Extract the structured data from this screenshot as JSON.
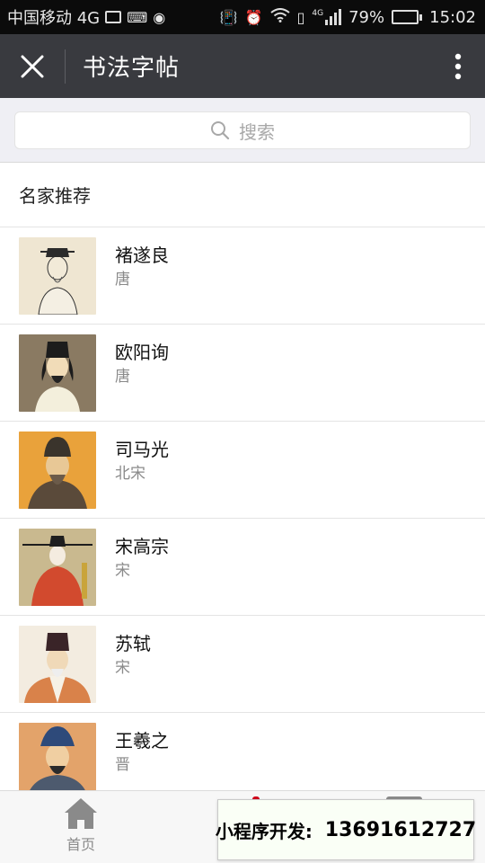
{
  "status_bar": {
    "carrier": "中国移动 4G",
    "signal_label": "4G",
    "battery": "79%",
    "battery_level": 0.79,
    "time": "15:02"
  },
  "header": {
    "title": "书法字帖"
  },
  "search": {
    "placeholder": "搜索"
  },
  "section": {
    "title": "名家推荐"
  },
  "calligraphers": [
    {
      "name": "褚遂良",
      "era": "唐"
    },
    {
      "name": "欧阳询",
      "era": "唐"
    },
    {
      "name": "司马光",
      "era": "北宋"
    },
    {
      "name": "宋高宗",
      "era": "宋"
    },
    {
      "name": "苏轼",
      "era": "宋"
    },
    {
      "name": "王羲之",
      "era": "晋"
    }
  ],
  "tabbar": {
    "home_label": "首页"
  },
  "promo": {
    "label": "小程序开发:",
    "phone": "13691612727"
  },
  "colors": {
    "title_bar": "#393a3f",
    "status_bar": "#0b0b0b",
    "search_bg": "#efeff4",
    "battery_fill": "#7ed321"
  }
}
